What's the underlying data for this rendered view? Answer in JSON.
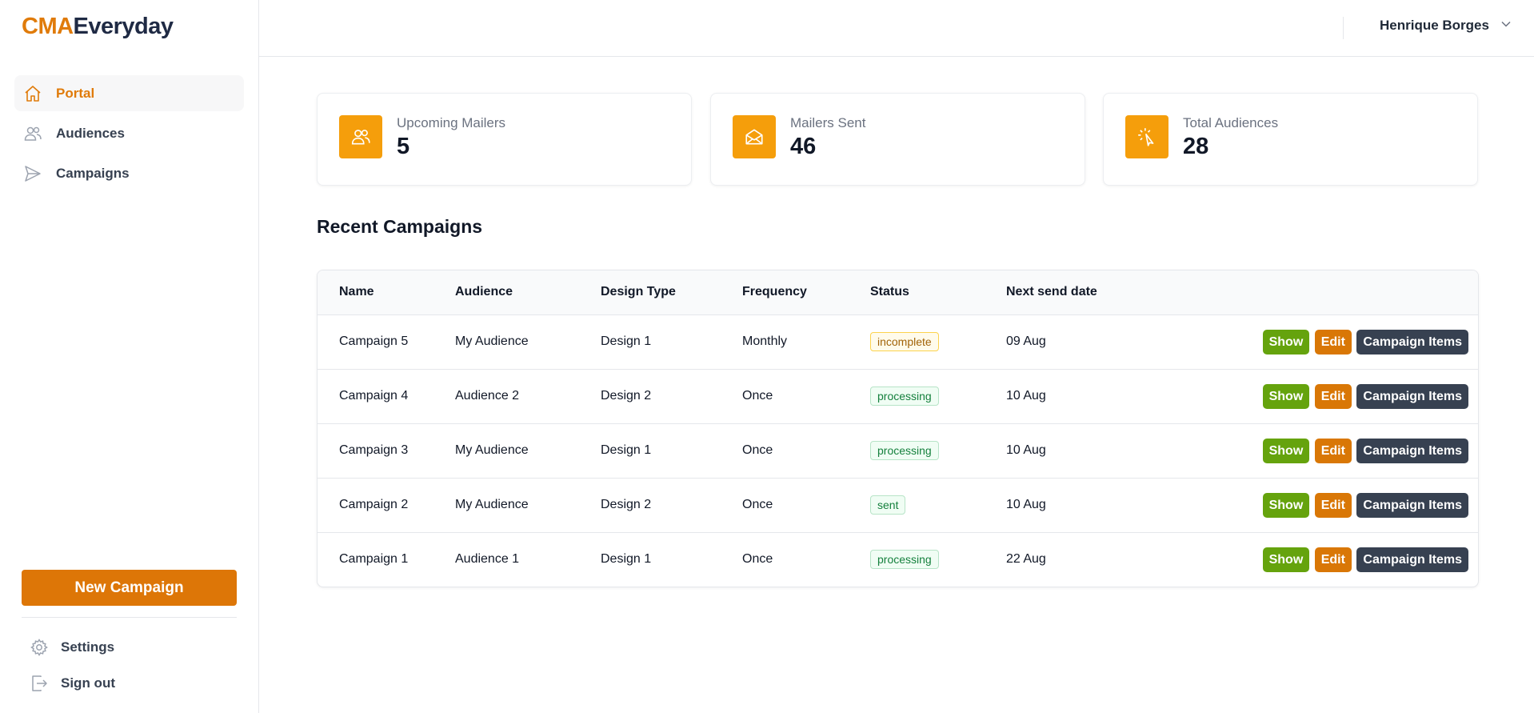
{
  "brand": {
    "part1": "CMA",
    "part2": "Everyday"
  },
  "sidebar": {
    "items": [
      {
        "label": "Portal",
        "icon": "home-icon",
        "active": true
      },
      {
        "label": "Audiences",
        "icon": "users-icon",
        "active": false
      },
      {
        "label": "Campaigns",
        "icon": "paper-plane-icon",
        "active": false
      }
    ],
    "new_campaign_label": "New Campaign",
    "bottom": [
      {
        "label": "Settings",
        "icon": "gear-icon"
      },
      {
        "label": "Sign out",
        "icon": "sign-out-icon"
      }
    ]
  },
  "header": {
    "user_name": "Henrique Borges"
  },
  "stats": [
    {
      "title": "Upcoming Mailers",
      "value": "5",
      "icon": "users-icon"
    },
    {
      "title": "Mailers Sent",
      "value": "46",
      "icon": "envelope-open-icon"
    },
    {
      "title": "Total Audiences",
      "value": "28",
      "icon": "cursor-click-icon"
    }
  ],
  "recent": {
    "title": "Recent Campaigns",
    "columns": [
      "Name",
      "Audience",
      "Design Type",
      "Frequency",
      "Status",
      "Next send date"
    ],
    "rows": [
      {
        "name": "Campaign 5",
        "audience": "My Audience",
        "design": "Design 1",
        "frequency": "Monthly",
        "status": "incomplete",
        "next": "09 Aug"
      },
      {
        "name": "Campaign 4",
        "audience": "Audience 2",
        "design": "Design 2",
        "frequency": "Once",
        "status": "processing",
        "next": "10 Aug"
      },
      {
        "name": "Campaign 3",
        "audience": "My Audience",
        "design": "Design 1",
        "frequency": "Once",
        "status": "processing",
        "next": "10 Aug"
      },
      {
        "name": "Campaign 2",
        "audience": "My Audience",
        "design": "Design 2",
        "frequency": "Once",
        "status": "sent",
        "next": "10 Aug"
      },
      {
        "name": "Campaign 1",
        "audience": "Audience 1",
        "design": "Design 1",
        "frequency": "Once",
        "status": "processing",
        "next": "22 Aug"
      }
    ],
    "action_labels": {
      "show": "Show",
      "edit": "Edit",
      "items": "Campaign Items"
    }
  },
  "colors": {
    "accent": "#dd7607",
    "stat_icon_bg": "#f59e0b",
    "show_button": "#65a30d",
    "edit_button": "#d97706",
    "items_button": "#374151"
  }
}
